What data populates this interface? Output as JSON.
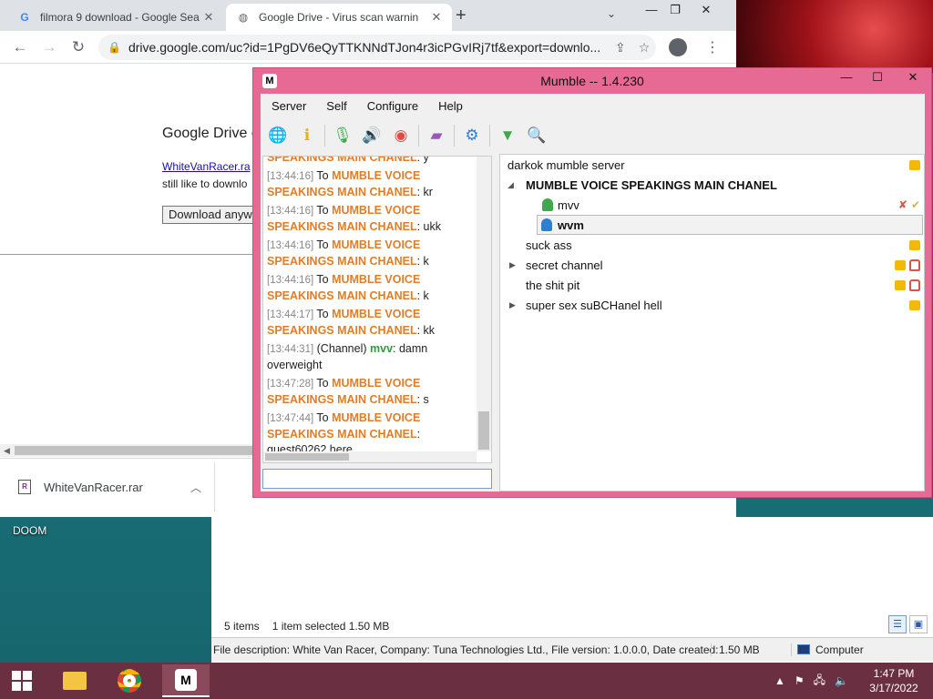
{
  "desktop": {
    "icon_label": "DOOM"
  },
  "chrome": {
    "tabs": [
      {
        "title": "filmora 9 download - Google Sea",
        "active": false
      },
      {
        "title": "Google Drive - Virus scan warnin",
        "active": true
      }
    ],
    "url": "drive.google.com/uc?id=1PgDV6eQyTTKNNdTJon4r3icPGvIRj7tf&export=downlo...",
    "page": {
      "title": "Google Drive c",
      "link": "WhiteVanRacer.ra",
      "text": "still like to downlo",
      "button": "Download anyw"
    },
    "download_shelf": {
      "filename": "WhiteVanRacer.rar"
    }
  },
  "explorer": {
    "items": "5 items",
    "selected": "1 item selected  1.50 MB",
    "details": "File description: White Van Racer, Company: Tuna Technologies Ltd., File version: 1.0.0.0, Date created:",
    "size": "1.50 MB",
    "location": "Computer"
  },
  "mumble": {
    "title": "Mumble -- 1.4.230",
    "menu": [
      "Server",
      "Self",
      "Configure",
      "Help"
    ],
    "toolbar_icons": [
      "globe-icon",
      "info-icon",
      "microphone-icon",
      "speaker-icon",
      "record-icon",
      "comment-icon",
      "settings-icon",
      "filter-icon",
      "search-icon"
    ],
    "chat": [
      {
        "ts": "",
        "prefix": "",
        "chan": "SPEAKINGS MAIN CHANEL",
        "suffix": ": y"
      },
      {
        "ts": "[13:44:16]",
        "prefix": " To ",
        "chan": "MUMBLE VOICE SPEAKINGS MAIN CHANEL",
        "suffix": ": kr"
      },
      {
        "ts": "[13:44:16]",
        "prefix": " To ",
        "chan": "MUMBLE VOICE SPEAKINGS MAIN CHANEL",
        "suffix": ": ukk"
      },
      {
        "ts": "[13:44:16]",
        "prefix": " To ",
        "chan": "MUMBLE VOICE SPEAKINGS MAIN CHANEL",
        "suffix": ": k"
      },
      {
        "ts": "[13:44:16]",
        "prefix": " To ",
        "chan": "MUMBLE VOICE SPEAKINGS MAIN CHANEL",
        "suffix": ": k"
      },
      {
        "ts": "[13:44:17]",
        "prefix": " To ",
        "chan": "MUMBLE VOICE SPEAKINGS MAIN CHANEL",
        "suffix": ": kk"
      },
      {
        "ts": "[13:44:31]",
        "prefix": " (Channel) ",
        "user": "mvv",
        "suffix": ": damn overweight"
      },
      {
        "ts": "[13:47:28]",
        "prefix": " To ",
        "chan": "MUMBLE VOICE SPEAKINGS MAIN CHANEL",
        "suffix": ": s"
      },
      {
        "ts": "[13:47:44]",
        "prefix": " To ",
        "chan": "MUMBLE VOICE SPEAKINGS MAIN CHANEL",
        "suffix": ": guest60262 here"
      }
    ],
    "tree": {
      "server": "darkok mumble server",
      "main_channel": "MUMBLE VOICE SPEAKINGS MAIN CHANEL",
      "users": [
        "mvv",
        "wvm"
      ],
      "channels": [
        "suck ass",
        "secret channel",
        "the shit pit",
        "super sex suBCHanel hell"
      ]
    }
  },
  "taskbar": {
    "time": "1:47 PM",
    "date": "3/17/2022"
  },
  "colors": {
    "mumble_frame": "#e66a94",
    "taskbar": "#6a3041",
    "channel_highlight": "#e07d2a",
    "user_highlight": "#2f9d3a"
  }
}
